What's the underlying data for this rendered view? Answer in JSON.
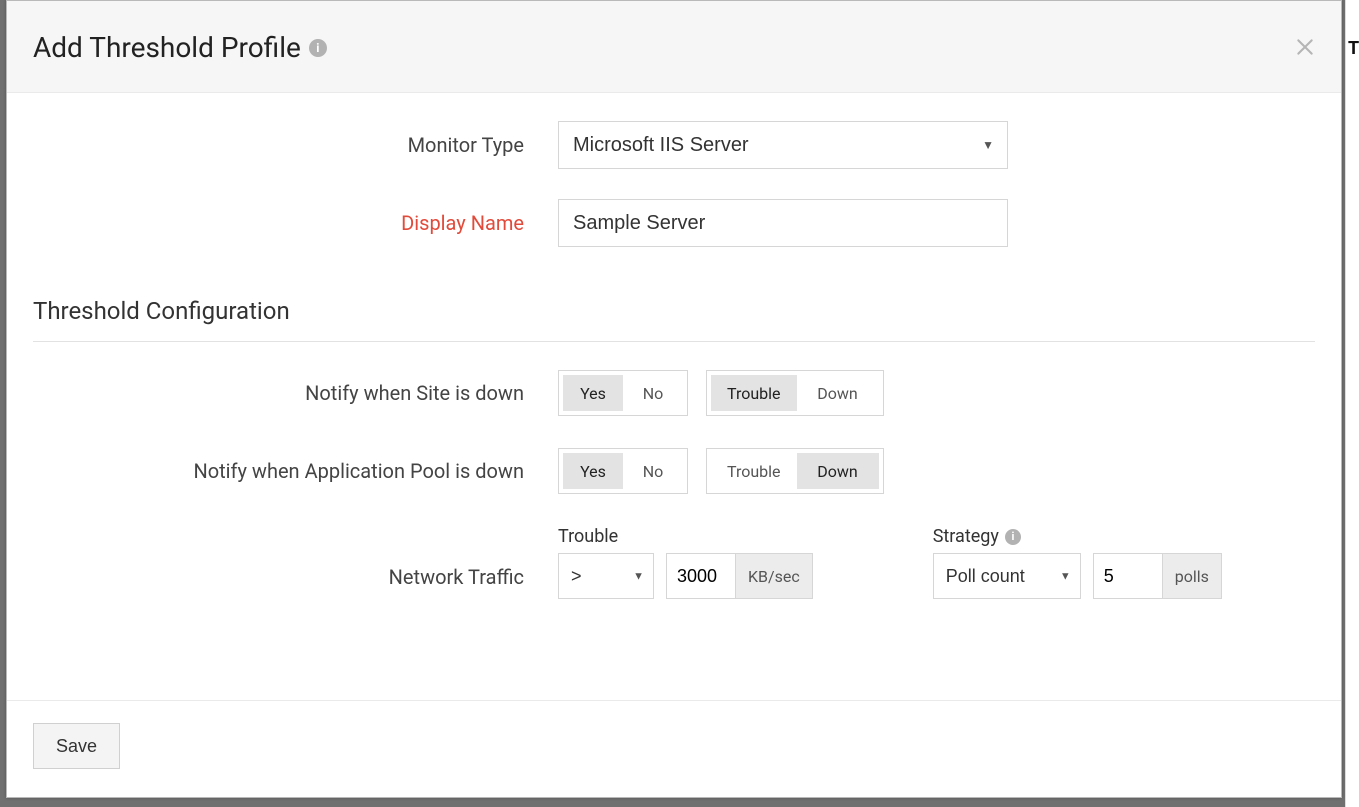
{
  "header": {
    "title": "Add Threshold Profile"
  },
  "right_edge": "T",
  "fields": {
    "monitor_type": {
      "label": "Monitor Type",
      "value": "Microsoft IIS Server"
    },
    "display_name": {
      "label": "Display Name",
      "value": "Sample Server"
    }
  },
  "section_title": "Threshold Configuration",
  "rows": {
    "site_down": {
      "label": "Notify when Site is down",
      "yn": {
        "yes": "Yes",
        "no": "No",
        "active": "yes"
      },
      "sev": {
        "trouble": "Trouble",
        "down": "Down",
        "active": "trouble"
      }
    },
    "app_pool_down": {
      "label": "Notify when Application Pool is down",
      "yn": {
        "yes": "Yes",
        "no": "No",
        "active": "yes"
      },
      "sev": {
        "trouble": "Trouble",
        "down": "Down",
        "active": "down"
      }
    },
    "network_traffic": {
      "label": "Network Traffic",
      "trouble_label": "Trouble",
      "operator": ">",
      "value": "3000",
      "unit": "KB/sec",
      "strategy_label": "Strategy",
      "strategy_value": "Poll count",
      "poll_value": "5",
      "poll_unit": "polls"
    }
  },
  "footer": {
    "save": "Save"
  }
}
